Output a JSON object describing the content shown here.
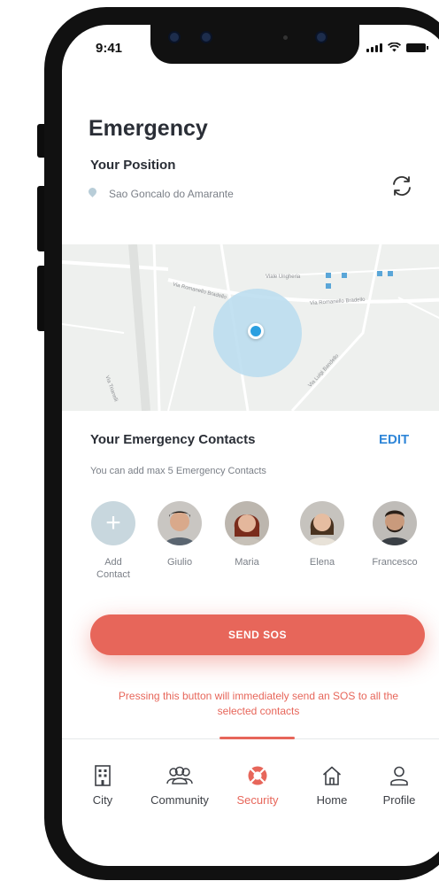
{
  "status_bar": {
    "time": "9:41",
    "icons": [
      "signal-icon",
      "wifi-icon",
      "battery-icon"
    ]
  },
  "header": {
    "title": "Emergency",
    "position_label": "Your Position",
    "location": "Sao Goncalo do Amarante",
    "refresh_icon": "refresh-icon"
  },
  "map": {
    "labels": [
      "Via Romanello Bradello",
      "Viale Ungheria",
      "Via Romanello Bradello",
      "Via Luigi Bandello",
      "Via Trianelli"
    ]
  },
  "contacts": {
    "title": "Your Emergency Contacts",
    "edit_label": "EDIT",
    "subtitle": "You can add max 5 Emergency Contacts",
    "add_label": "Add Contact",
    "people": [
      {
        "name": "Giulio",
        "hair": "#1e1a17",
        "skin": "#d9a98b",
        "shirt": "#5a6570"
      },
      {
        "name": "Maria",
        "hair": "#7a2c1c",
        "skin": "#e4b79c",
        "shirt": "#c7c1b8"
      },
      {
        "name": "Elena",
        "hair": "#4a3320",
        "skin": "#e6bda1",
        "shirt": "#e8e2d8"
      },
      {
        "name": "Francesco",
        "hair": "#2a1f18",
        "skin": "#c99a7c",
        "shirt": "#3a3f45"
      }
    ]
  },
  "sos": {
    "button_label": "SEND SOS",
    "warning": "Pressing this button will immediately send an SOS to all the selected contacts"
  },
  "tabs": [
    {
      "label": "City",
      "icon": "building-icon",
      "active": false
    },
    {
      "label": "Community",
      "icon": "people-icon",
      "active": false
    },
    {
      "label": "Security",
      "icon": "lifebuoy-icon",
      "active": true
    },
    {
      "label": "Home",
      "icon": "home-icon",
      "active": false
    },
    {
      "label": "Profile",
      "icon": "user-icon",
      "active": false
    }
  ],
  "colors": {
    "accent": "#e7665a",
    "link": "#2f86d8",
    "map_marker": "#2b9fe0",
    "map_radius": "#b9dcee"
  }
}
